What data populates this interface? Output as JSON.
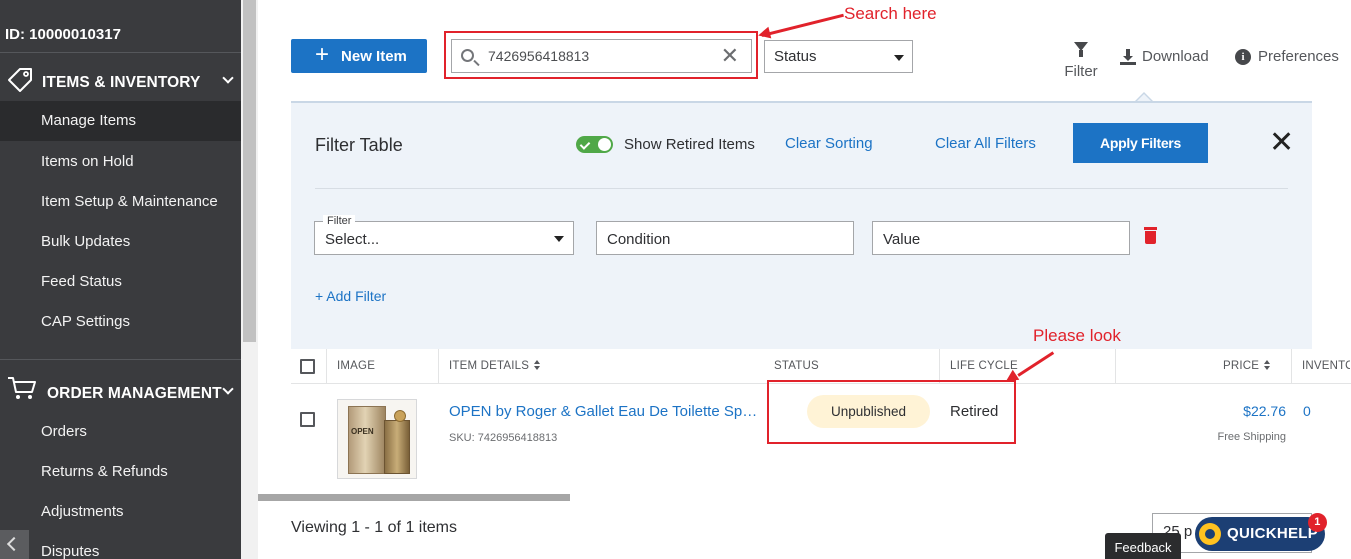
{
  "sidebar": {
    "seller_id": "ID: 10000010317",
    "sections": [
      {
        "label": "ITEMS & INVENTORY",
        "icon": "tag-icon"
      },
      {
        "label": "ORDER MANAGEMENT",
        "icon": "cart-icon"
      }
    ],
    "items_inventory": [
      "Manage Items",
      "Items on Hold",
      "Item Setup & Maintenance",
      "Bulk Updates",
      "Feed Status",
      "CAP Settings"
    ],
    "order_management": [
      "Orders",
      "Returns & Refunds",
      "Adjustments",
      "Disputes"
    ],
    "active_item": "Manage Items"
  },
  "toolbar": {
    "new_item_label": "New Item",
    "search_value": "7426956418813",
    "status_label": "Status",
    "filter_label": "Filter",
    "download_label": "Download",
    "preferences_label": "Preferences"
  },
  "annotations": {
    "search_note": "Search here",
    "status_note": "Please look",
    "color": "#e1222b"
  },
  "filter_panel": {
    "title": "Filter Table",
    "show_retired_label": "Show Retired Items",
    "show_retired_on": true,
    "clear_sorting": "Clear Sorting",
    "clear_all_filters": "Clear All Filters",
    "apply_filters": "Apply Filters",
    "filter_field_label": "Filter",
    "filter_select": "Select...",
    "condition_placeholder": "Condition",
    "value_placeholder": "Value",
    "add_filter": "+ Add Filter"
  },
  "table": {
    "columns": [
      "IMAGE",
      "ITEM DETAILS",
      "STATUS",
      "LIFE CYCLE",
      "PRICE",
      "INVENTO"
    ],
    "rows": [
      {
        "name": "OPEN by Roger & Gallet Eau De Toilette Spray",
        "sku": "SKU: 7426956418813",
        "status": "Unpublished",
        "lifecycle": "Retired",
        "price": "$22.76",
        "shipping": "Free Shipping",
        "inventory": "0",
        "image_label": "OPEN"
      }
    ]
  },
  "footer": {
    "viewing": "Viewing 1 - 1 of 1 items",
    "per_page": "25 p",
    "feedback": "Feedback",
    "quickhelp": "QUICKHELP",
    "quickhelp_count": "1"
  },
  "colors": {
    "primary": "#1c73c5",
    "sidebar_bg": "#3a3b3e",
    "badge_unpublished": "#fff3d6",
    "toggle_on": "#50a848"
  }
}
